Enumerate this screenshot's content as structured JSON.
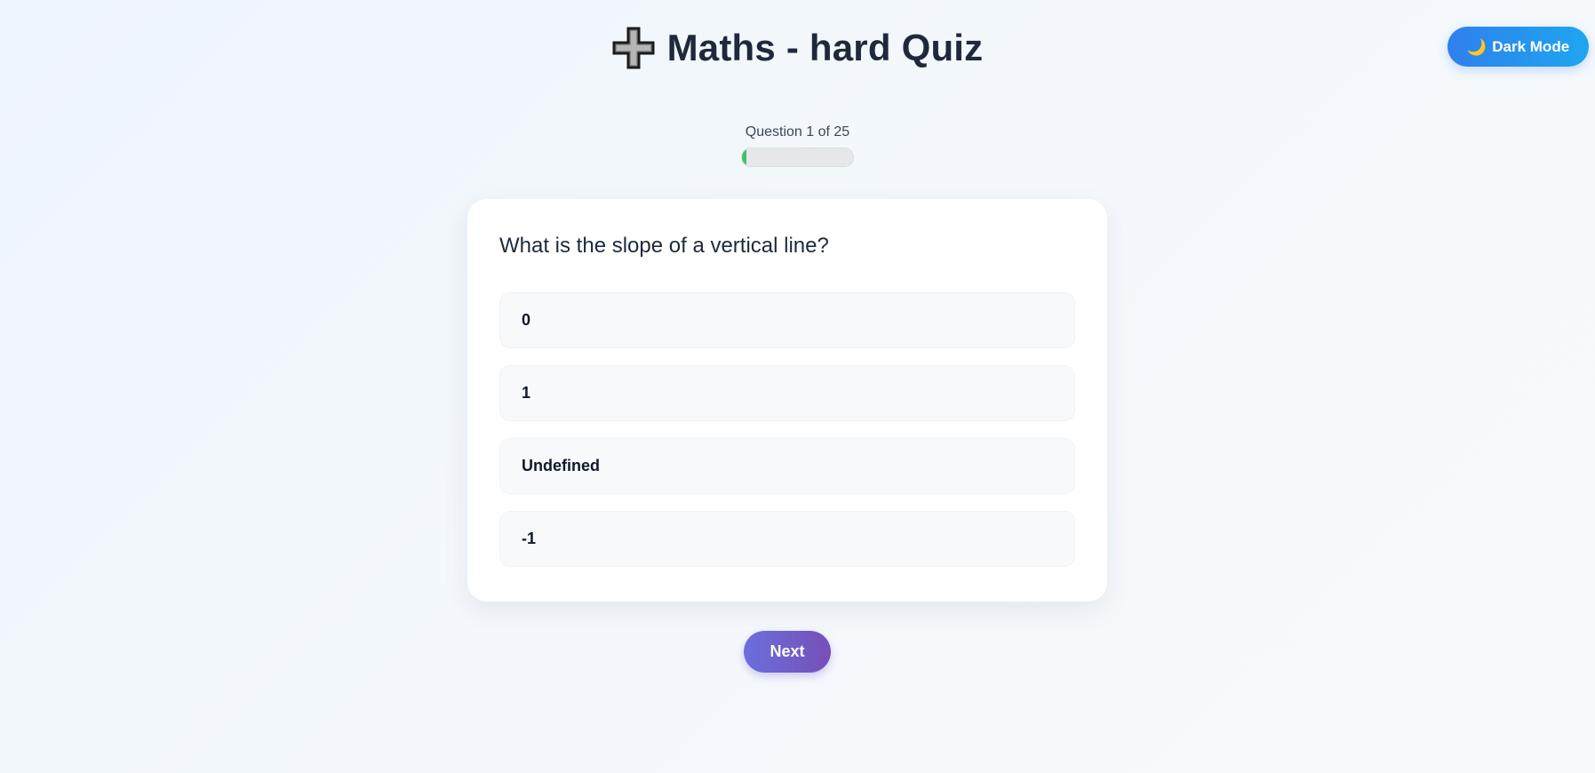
{
  "theme_toggle": {
    "icon": "moon-icon",
    "icon_glyph": "🌙",
    "label": "Dark Mode"
  },
  "header": {
    "icon": "plus-icon",
    "title": "Maths - hard Quiz"
  },
  "progress": {
    "label": "Question 1 of 25",
    "current": 1,
    "total": 25,
    "fraction": 0.04
  },
  "question": {
    "text": "What is the slope of a vertical line?",
    "options": [
      "0",
      "1",
      "Undefined",
      "-1"
    ]
  },
  "navigation": {
    "next_label": "Next"
  },
  "colors": {
    "accent_blue": "#2f80ed",
    "progress_green": "#3ac55e",
    "next_purple": "#7650b8"
  }
}
